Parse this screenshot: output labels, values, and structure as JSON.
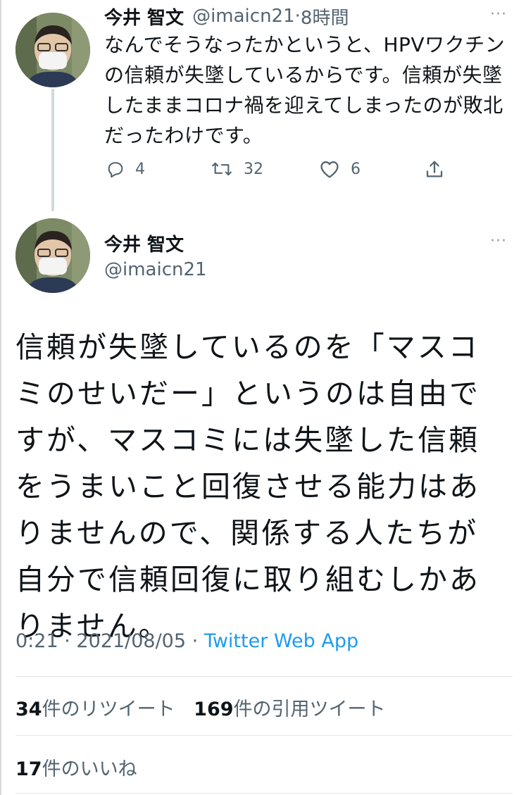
{
  "tweet1": {
    "display_name": "今井 智文",
    "handle": "@imaicn21",
    "separator": "·",
    "time": "8時間",
    "text": "なんでそうなったかというと、HPVワクチンの信頼が失墜しているからです。信頼が失墜したままコロナ禍を迎えてしまったのが敗北だったわけです。",
    "replies": "4",
    "retweets": "32",
    "likes": "6",
    "more": "···"
  },
  "tweet2": {
    "display_name": "今井 智文",
    "handle": "@imaicn21",
    "more": "···",
    "text": "信頼が失墜しているのを「マスコミのせいだー」というのは自由ですが、マスコミには失墜した信頼をうまいこと回復させる能力はありませんので、関係する人たちが自分で信頼回復に取り組むしかありません。",
    "time": "0:21",
    "date": "2021/08/05",
    "dot": "·",
    "source": "Twitter Web App",
    "retweet_count": "34",
    "retweet_label": "件のリツイート",
    "quote_count": "169",
    "quote_label": "件の引用ツイート",
    "like_count": "17",
    "like_label": "件のいいね"
  },
  "icons": {
    "reply": "reply-icon",
    "retweet": "retweet-icon",
    "like": "heart-icon",
    "share": "share-icon"
  },
  "colors": {
    "link": "#1d9bf0",
    "muted": "#536471",
    "text": "#0f1419"
  }
}
